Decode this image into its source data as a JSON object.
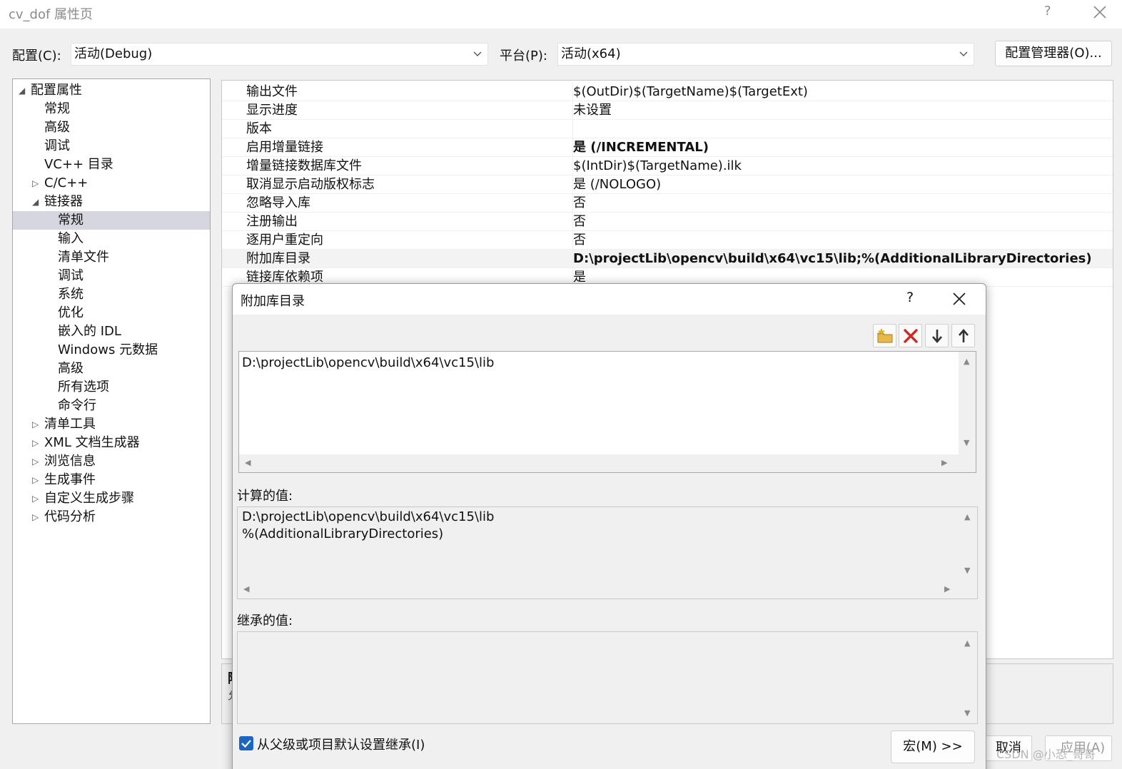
{
  "window": {
    "title": "cv_dof 属性页",
    "help": "?"
  },
  "config": {
    "config_label": "配置(C):",
    "config_value": "活动(Debug)",
    "platform_label": "平台(P):",
    "platform_value": "活动(x64)",
    "manager_button": "配置管理器(O)..."
  },
  "tree": {
    "items": [
      {
        "label": "配置属性",
        "arrow": "◢"
      },
      {
        "label": "常规",
        "arrow": ""
      },
      {
        "label": "高级",
        "arrow": ""
      },
      {
        "label": "调试",
        "arrow": ""
      },
      {
        "label": "VC++ 目录",
        "arrow": ""
      },
      {
        "label": "C/C++",
        "arrow": "▷"
      },
      {
        "label": "链接器",
        "arrow": "◢"
      },
      {
        "label": "常规",
        "arrow": ""
      },
      {
        "label": "输入",
        "arrow": ""
      },
      {
        "label": "清单文件",
        "arrow": ""
      },
      {
        "label": "调试",
        "arrow": ""
      },
      {
        "label": "系统",
        "arrow": ""
      },
      {
        "label": "优化",
        "arrow": ""
      },
      {
        "label": "嵌入的 IDL",
        "arrow": ""
      },
      {
        "label": "Windows 元数据",
        "arrow": ""
      },
      {
        "label": "高级",
        "arrow": ""
      },
      {
        "label": "所有选项",
        "arrow": ""
      },
      {
        "label": "命令行",
        "arrow": ""
      },
      {
        "label": "清单工具",
        "arrow": "▷"
      },
      {
        "label": "XML 文档生成器",
        "arrow": "▷"
      },
      {
        "label": "浏览信息",
        "arrow": "▷"
      },
      {
        "label": "生成事件",
        "arrow": "▷"
      },
      {
        "label": "自定义生成步骤",
        "arrow": "▷"
      },
      {
        "label": "代码分析",
        "arrow": "▷"
      }
    ]
  },
  "grid": {
    "rows": [
      {
        "name": "输出文件",
        "value": "$(OutDir)$(TargetName)$(TargetExt)"
      },
      {
        "name": "显示进度",
        "value": "未设置"
      },
      {
        "name": "版本",
        "value": ""
      },
      {
        "name": "启用增量链接",
        "value": "是 (/INCREMENTAL)"
      },
      {
        "name": "增量链接数据库文件",
        "value": "$(IntDir)$(TargetName).ilk"
      },
      {
        "name": "取消显示启动版权标志",
        "value": "是 (/NOLOGO)"
      },
      {
        "name": "忽略导入库",
        "value": "否"
      },
      {
        "name": "注册输出",
        "value": "否"
      },
      {
        "name": "逐用户重定向",
        "value": "否"
      },
      {
        "name": "附加库目录",
        "value": "D:\\projectLib\\opencv\\build\\x64\\vc15\\lib;%(AdditionalLibraryDirectories)"
      },
      {
        "name": "链接库依赖项",
        "value": "是"
      }
    ]
  },
  "desc": {
    "glyph1": "附",
    "glyph2": "允"
  },
  "footer": {
    "cancel": "取消",
    "apply": "应用(A)",
    "watermark": "CSDN @小恐_哥哥"
  },
  "modal": {
    "title": "附加库目录",
    "help": "?",
    "edit_text": "D:\\projectLib\\opencv\\build\\x64\\vc15\\lib",
    "computed_label": "计算的值:",
    "computed_line1": "D:\\projectLib\\opencv\\build\\x64\\vc15\\lib",
    "computed_line2": "%(AdditionalLibraryDirectories)",
    "inherited_label": "继承的值:",
    "inherit_checkbox": "从父级或项目默认设置继承(I)",
    "macro_button": "宏(M) >>"
  }
}
